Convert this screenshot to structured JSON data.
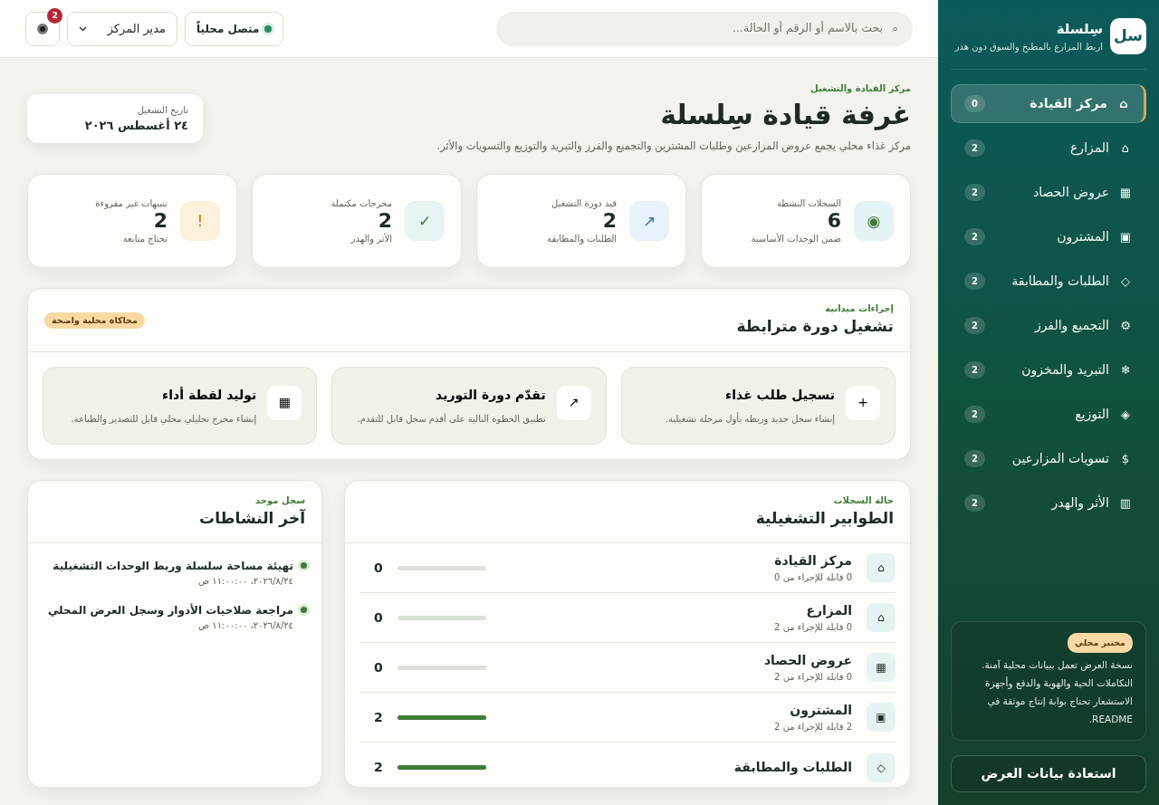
{
  "topbar": {
    "search": {
      "icon": "⌕",
      "placeholder": "بحث بالاسم أو الرقم أو الحالة..."
    },
    "status": "متصل محلياً",
    "role_select": "مدير المركز",
    "notifications": "2"
  },
  "header": {
    "eyebrow": "مركز القيادة والتشغيل",
    "title": "غرفة قيادة سِلسلة",
    "subtitle": "مركز غذاء محلي يجمع عروض المزارعين وطلبات المشترين والتجميع والفرز والتبريد والتوزيع والتسويات والأثر.",
    "date_label": "تاريخ التشغيل",
    "date": "٢٤ أغسطس ٢٠٢٦"
  },
  "stats": [
    {
      "kind": "info",
      "icon": "◉",
      "label": "السجلات النشطة",
      "value": "6",
      "sub": "ضمن الوحدات الأساسية"
    },
    {
      "kind": "progress",
      "icon": "↗",
      "label": "قيد دورة التشغيل",
      "value": "2",
      "sub": "الطلبات والمطابقة"
    },
    {
      "kind": "done",
      "icon": "✓",
      "label": "مخرجات مكتملة",
      "value": "2",
      "sub": "الأثر والهدر"
    },
    {
      "kind": "alert",
      "icon": "!",
      "label": "تنبيهات غير مقروءة",
      "value": "2",
      "sub": "تحتاج متابعة"
    }
  ],
  "actions_panel": {
    "eyebrow": "إجراءات ميدانية",
    "title": "تشغيل دورة مترابطة",
    "badge": "محاكاة محلية واضحة",
    "actions": [
      {
        "icon": "+",
        "title": "تسجيل طلب غذاء",
        "text": "إنشاء سجل جديد وربطه بأول مرحلة تشغيلية."
      },
      {
        "icon": "↗",
        "title": "تقدّم دورة التوريد",
        "text": "تطبيق الخطوة التالية على أقدم سجل قابل للتقدم."
      },
      {
        "icon": "▦",
        "title": "توليد لقطة أداء",
        "text": "إنشاء مخرج تحليلي محلي قابل للتصدير والطباعة."
      }
    ]
  },
  "queues": {
    "eyebrow": "حالة السجلات",
    "title": "الطوابير التشغيلية",
    "rows": [
      {
        "icon": "⌂",
        "title": "مركز القيادة",
        "sub": "0 قابلة للإجراء من 0",
        "value": "0",
        "level": 0
      },
      {
        "icon": "⌂",
        "title": "المزارع",
        "sub": "0 قابلة للإجراء من 2",
        "value": "0",
        "level": 0
      },
      {
        "icon": "▦",
        "title": "عروض الحصاد",
        "sub": "0 قابلة للإجراء من 2",
        "value": "0",
        "level": 0
      },
      {
        "icon": "▣",
        "title": "المشترون",
        "sub": "2 قابلة للإجراء من 2",
        "value": "2",
        "level": 1
      },
      {
        "icon": "◇",
        "title": "الطلبات والمطابقة",
        "value": "2",
        "level": 1
      }
    ]
  },
  "activity": {
    "eyebrow": "سجل موحد",
    "title": "آخر النشاطات",
    "items": [
      {
        "text": "تهيئة مساحة سلسلة وربط الوحدات التشغيلية",
        "time": "٢٠٢٦/٨/٢٤، ١١:٠٠:٠٠ ص"
      },
      {
        "text": "مراجعة صلاحيات الأدوار وسجل العرض المحلي",
        "time": "٢٠٢٦/٨/٢٤، ١١:٠٠:٠٠ ص"
      }
    ]
  },
  "sidebar": {
    "logo": "سل",
    "brand": "سِلسلة",
    "tagline": "اربط المزارع بالمطبخ والسوق دون هدر",
    "nav": [
      {
        "icon": "⌂",
        "label": "مركز القيادة",
        "count": "0",
        "selected": true
      },
      {
        "icon": "⌂",
        "label": "المزارع",
        "count": "2",
        "selected": false
      },
      {
        "icon": "▦",
        "label": "عروض الحصاد",
        "count": "2",
        "selected": false
      },
      {
        "icon": "▣",
        "label": "المشترون",
        "count": "2",
        "selected": false
      },
      {
        "icon": "◇",
        "label": "الطلبات والمطابقة",
        "count": "2",
        "selected": false
      },
      {
        "icon": "⚙",
        "label": "التجميع والفرز",
        "count": "2",
        "selected": false
      },
      {
        "icon": "❄",
        "label": "التبريد والمخزون",
        "count": "2",
        "selected": false
      },
      {
        "icon": "◈",
        "label": "التوزيع",
        "count": "2",
        "selected": false
      },
      {
        "icon": "$",
        "label": "تسويات المزارعين",
        "count": "2",
        "selected": false
      },
      {
        "icon": "▥",
        "label": "الأثر والهدر",
        "count": "2",
        "selected": false
      }
    ],
    "note": {
      "badge": "مختبر محلي",
      "text": "نسخة العرض تعمل ببيانات محلية آمنة. التكاملات الحية والهوية والدفع وأجهزة الاستشعار تحتاج بوابة إنتاج موثقة في README."
    },
    "restore_button": "استعادة بيانات العرض"
  }
}
